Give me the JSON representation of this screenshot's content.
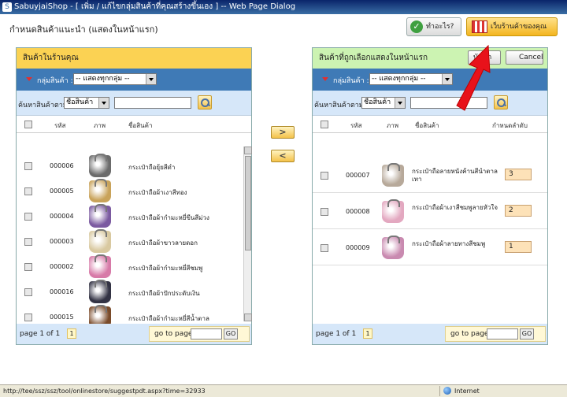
{
  "window": {
    "title": "SabuyjaiShop - [ เพิ่ม / แก้ไขกลุ่มสินค้าที่คุณสร้างขึ้นเอง ] -- Web Page Dialog"
  },
  "page": {
    "title": "กำหนดสินค้าแนะนำ (แสดงในหน้าแรก)"
  },
  "header_buttons": {
    "help": "ทำอะไร?",
    "shop": "เว็บร้านค้าของคุณ"
  },
  "left_panel": {
    "title": "สินค้าในร้านคุณ",
    "group_label": "กลุ่มสินค้า :",
    "group_value": "-- แสดงทุกกลุ่ม --",
    "search_label": "ค้นหาสินค้าตาม :",
    "search_by": "ชื่อสินค้า",
    "search_value": "",
    "columns": {
      "code": "รหัส",
      "image": "ภาพ",
      "name": "ชื่อสินค้า"
    },
    "rows": [
      {
        "code": "000006",
        "name": "กระเป๋าถือยุ้ยสีดำ",
        "color": "#6b6b6b"
      },
      {
        "code": "000005",
        "name": "กระเป๋าถือผ้าเงาสีทอง",
        "color": "#c9a35a"
      },
      {
        "code": "000004",
        "name": "กระเป๋าถือผ้ากำมะหยี่ขีนสีม่วง",
        "color": "#7b5aa0"
      },
      {
        "code": "000003",
        "name": "กระเป๋าถือผ้าขาวลายดอก",
        "color": "#d9c9a0"
      },
      {
        "code": "000002",
        "name": "กระเป๋าถือผ้ากำมะหยี่สีชมพู",
        "color": "#d77aa8"
      },
      {
        "code": "000016",
        "name": "กระเป๋าถือผ้าปักประดับเงิน",
        "color": "#333344"
      },
      {
        "code": "000015",
        "name": "กระเป๋าถือผ้ากำมะหยี่สีน้ำตาล",
        "color": "#7a4b2a"
      }
    ],
    "pager": {
      "info": "page 1 of 1",
      "page": "1",
      "goto_label": "go to page",
      "goto_value": "",
      "go_button": "GO"
    }
  },
  "right_panel": {
    "title": "สินค้าที่ถูกเลือกแสดงในหน้าแรก",
    "save_button": "บันทึก",
    "cancel_button": "Cancel",
    "group_label": "กลุ่มสินค้า :",
    "group_value": "-- แสดงทุกกลุ่ม --",
    "search_label": "ค้นหาสินค้าตาม :",
    "search_by": "ชื่อสินค้า",
    "search_value": "",
    "columns": {
      "code": "รหัส",
      "image": "ภาพ",
      "name": "ชื่อสินค้า",
      "order": "กำหนดลำดับ"
    },
    "rows": [
      {
        "code": "000007",
        "name": "กระเป๋าถือลายหนังค้านสีน้ำตาลเทา",
        "order": "3",
        "color": "#b7a99a"
      },
      {
        "code": "000008",
        "name": "กระเป๋าถือผ้าเงาสีชมพูลายหัวใจ",
        "order": "2",
        "color": "#e3a8c0"
      },
      {
        "code": "000009",
        "name": "กระเป๋าถือผ้าลายทางสีชมพู",
        "order": "1",
        "color": "#c98ab0"
      }
    ],
    "pager": {
      "info": "page 1 of 1",
      "page": "1",
      "goto_label": "go to page",
      "goto_value": "",
      "go_button": "GO"
    }
  },
  "move_buttons": {
    "add": ">",
    "remove": "<"
  },
  "statusbar": {
    "url": "http://tee/ssz/ssz/tool/onlinestore/suggestpdt.aspx?time=32933",
    "zone": "Internet"
  },
  "colors": {
    "left_header": "#fbd253",
    "right_header": "#ccf3b2",
    "filter_bar": "#3f7ab6",
    "search_bar": "#d6e7f9",
    "arrow": "#e8121a"
  }
}
